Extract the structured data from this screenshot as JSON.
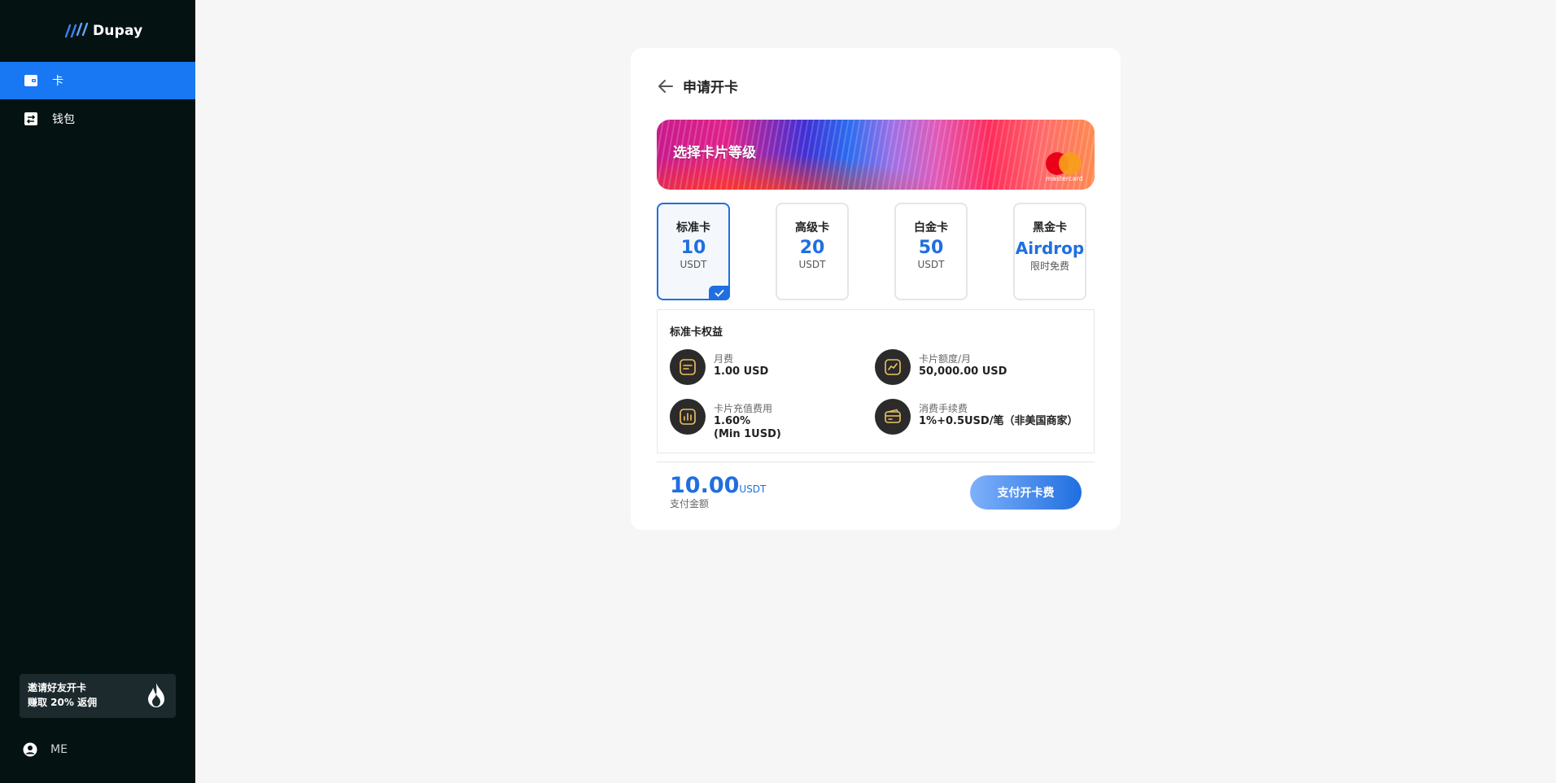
{
  "sidebar": {
    "logo_text": "Dupay",
    "nav": [
      {
        "label": "卡",
        "icon": "wallet-card-icon",
        "active": true
      },
      {
        "label": "钱包",
        "icon": "transfer-icon",
        "active": false
      }
    ],
    "invite": {
      "line1": "邀请好友开卡",
      "line2": "赚取 20% 返佣",
      "icon": "flame-icon"
    },
    "me_label": "ME"
  },
  "main": {
    "title": "申请开卡",
    "banner": {
      "title": "选择卡片等级",
      "brand_text": "mastercard"
    },
    "tiers": [
      {
        "name": "标准卡",
        "price": "10",
        "unit": "USDT",
        "selected": true
      },
      {
        "name": "高级卡",
        "price": "20",
        "unit": "USDT",
        "selected": false
      },
      {
        "name": "白金卡",
        "price": "50",
        "unit": "USDT",
        "selected": false
      },
      {
        "name": "黑金卡",
        "price": "Airdrop",
        "unit": "限时免费",
        "selected": false
      }
    ],
    "benefits": {
      "title": "标准卡权益",
      "items": [
        {
          "label": "月费",
          "value": "1.00 USD",
          "icon": "receipt-icon"
        },
        {
          "label": "卡片额度/月",
          "value": "50,000.00 USD",
          "icon": "trend-chart-icon"
        },
        {
          "label": "卡片充值费用",
          "value": "1.60%",
          "value2": "(Min 1USD)",
          "icon": "bar-chart-icon"
        },
        {
          "label": "消费手续费",
          "value": "1%+0.5USD/笔（非美国商家）",
          "icon": "card-icon"
        }
      ]
    },
    "payment": {
      "amount": "10.00",
      "unit": "USDT",
      "label": "支付金额",
      "button": "支付开卡费"
    }
  },
  "colors": {
    "accent": "#1f6fe0",
    "sidebar_bg": "#041312",
    "nav_active": "#1877f2",
    "icon_accent": "#f0c060"
  }
}
